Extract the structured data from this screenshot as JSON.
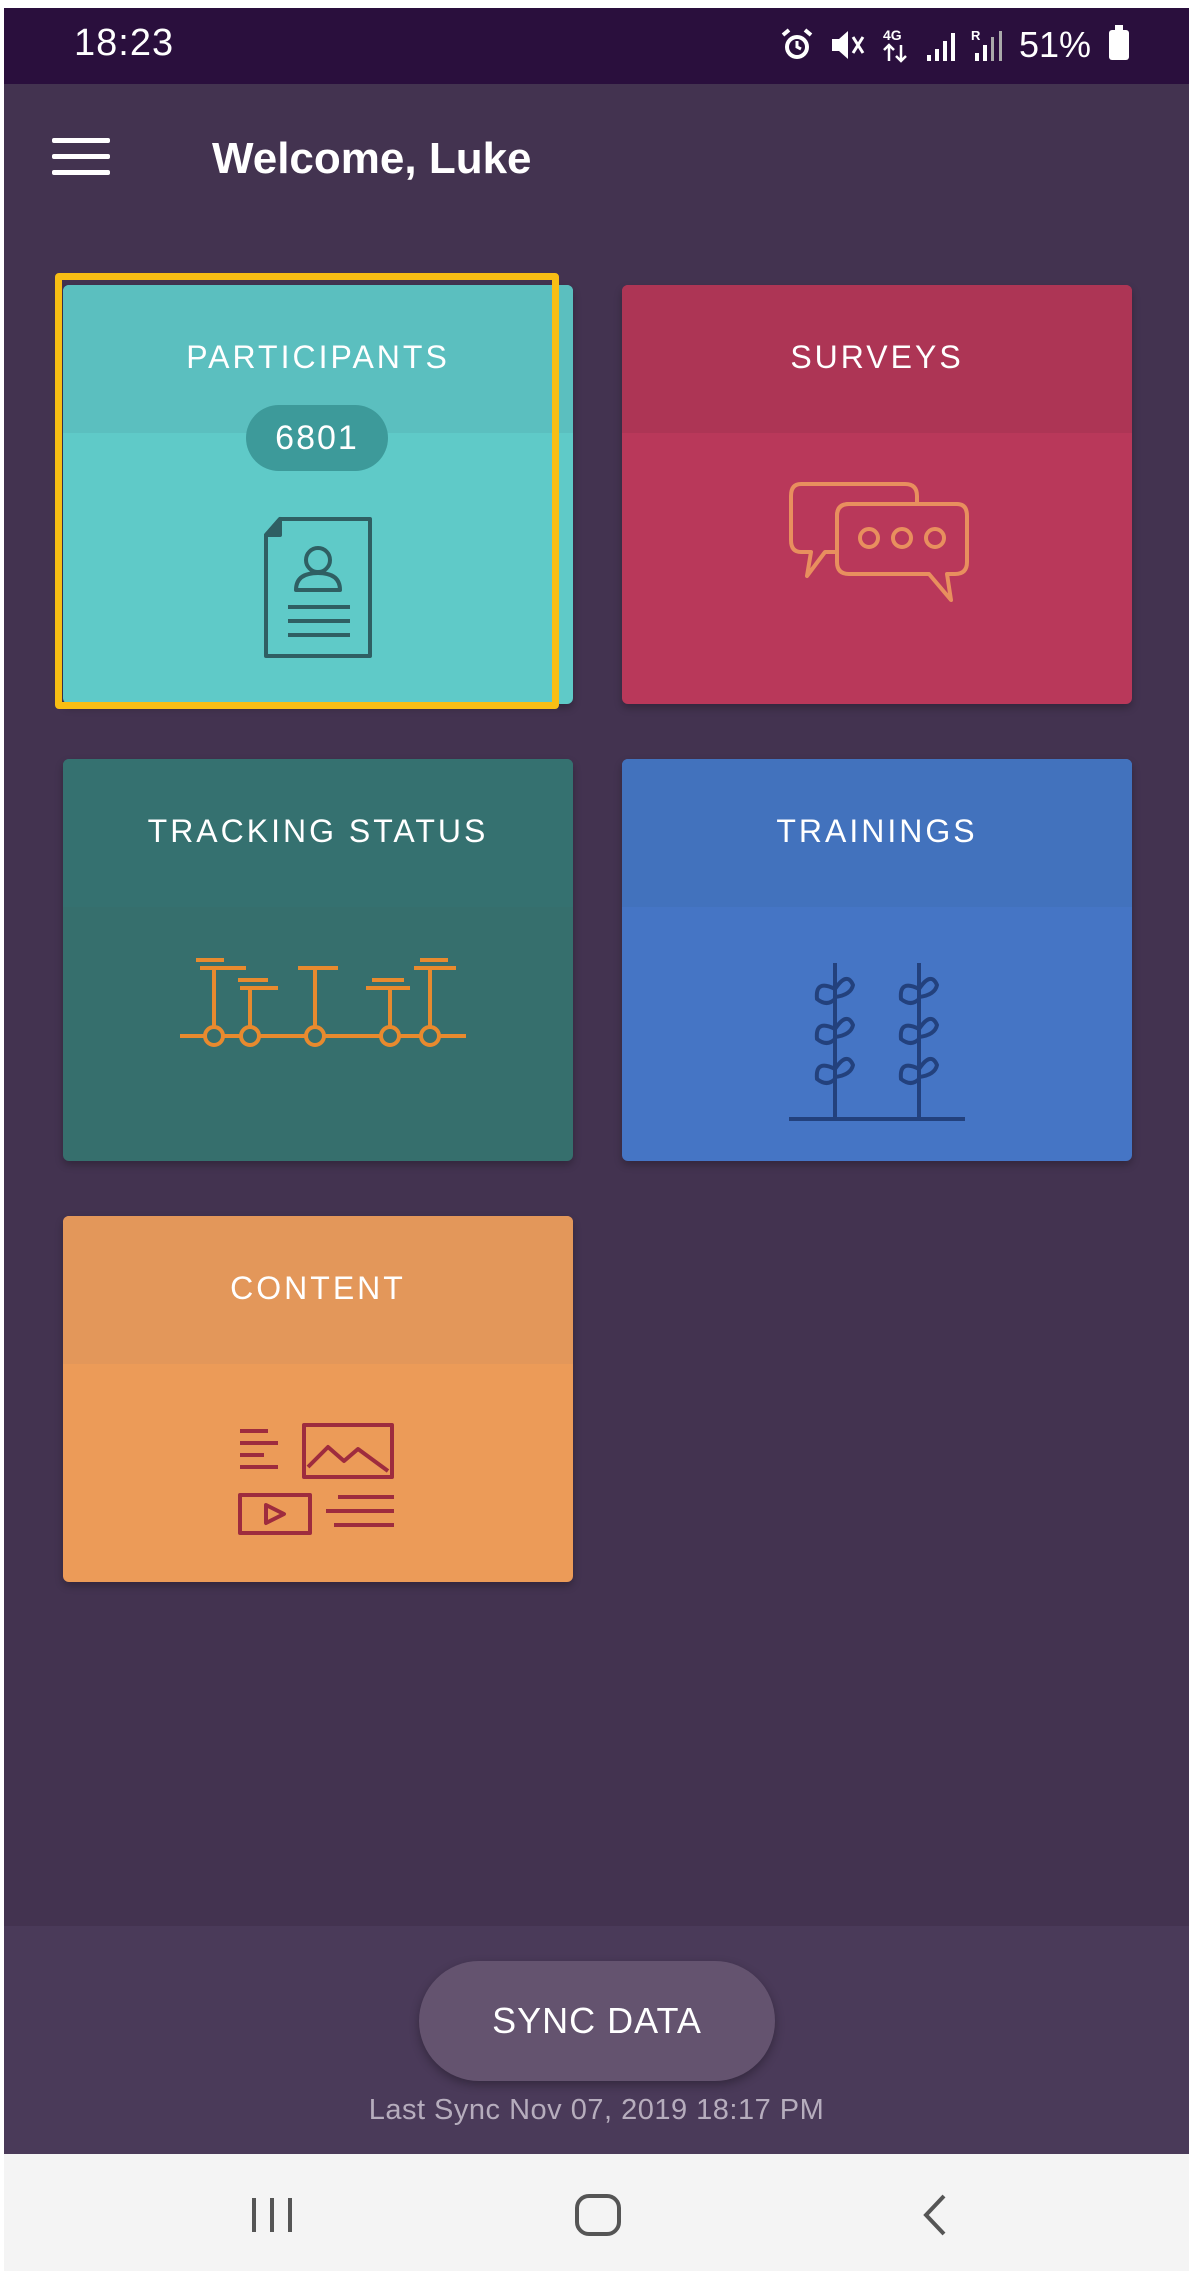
{
  "status_bar": {
    "time": "18:23",
    "network": "4G",
    "battery": "51%",
    "icons": [
      "alarm-icon",
      "mute-icon",
      "data-arrows-icon",
      "signal-icon",
      "roaming-signal-icon",
      "battery-icon"
    ]
  },
  "header": {
    "title": "Welcome, Luke",
    "menu_icon": "hamburger-menu-icon"
  },
  "tiles": [
    {
      "label": "PARTICIPANTS",
      "badge": "6801",
      "icon": "participant-document-icon",
      "color": "#5fcac8",
      "selected": true
    },
    {
      "label": "SURVEYS",
      "icon": "chat-bubbles-icon",
      "color": "#b9385a"
    },
    {
      "label": "TRACKING STATUS",
      "icon": "timeline-icon",
      "color": "#366f6d"
    },
    {
      "label": "TRAININGS",
      "icon": "plants-icon",
      "color": "#4575c5"
    },
    {
      "label": "CONTENT",
      "icon": "media-content-icon",
      "color": "#ec9b58"
    }
  ],
  "footer": {
    "sync_button": "SYNC DATA",
    "last_sync": "Last Sync Nov 07, 2019 18:17 PM"
  },
  "colors": {
    "background": "#433350",
    "status_bar": "#2a0f3d",
    "selection": "#f8be14"
  },
  "nav_bar": {
    "icons": [
      "recent-apps-icon",
      "home-icon",
      "back-icon"
    ]
  }
}
